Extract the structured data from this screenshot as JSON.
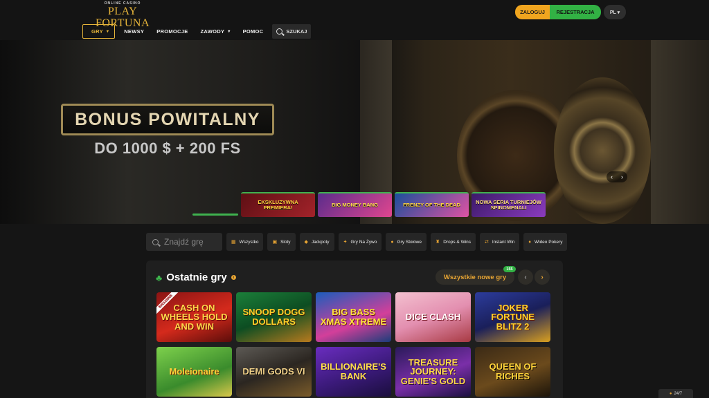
{
  "logo": {
    "subtitle": "ONLINE CASINO",
    "name": "PLAY FORTUNA"
  },
  "nav": {
    "items": [
      {
        "label": "GRY",
        "dropdown": true
      },
      {
        "label": "NEWSY"
      },
      {
        "label": "PROMOCJE"
      },
      {
        "label": "ZAWODY",
        "dropdown": true
      },
      {
        "label": "POMOC"
      }
    ],
    "search_label": "SZUKAJ",
    "caret": "▾"
  },
  "auth": {
    "login": "ZALOGUJ",
    "register": "REJESTRACJA"
  },
  "language": "PL ▾",
  "hero": {
    "title": "BONUS POWITALNY",
    "amount": "DO 1000 $ + 200 FS",
    "prev": "‹",
    "next": "›",
    "tabs": [
      {
        "label": "EKSKLUZYWNA PREMIERA!"
      },
      {
        "label": "BIG MONEY BANG"
      },
      {
        "label": "FRENZY OF THE DEAD"
      },
      {
        "label": "NOWA SERIA TURNIEJÓW SPINOMENALI"
      }
    ]
  },
  "filters": {
    "search_placeholder": "Znajdź grę",
    "chips": [
      {
        "icon": "▦",
        "label": "Wszystko"
      },
      {
        "icon": "▣",
        "label": "Sloty"
      },
      {
        "icon": "◆",
        "label": "Jackpoty"
      },
      {
        "icon": "✦",
        "label": "Gry Na Żywo"
      },
      {
        "icon": "●",
        "label": "Gry Stołowe"
      },
      {
        "icon": "♜",
        "label": "Drops & Wins"
      },
      {
        "icon": "⇄",
        "label": "Instant Win"
      },
      {
        "icon": "♦",
        "label": "Wideo Pokery"
      }
    ]
  },
  "recent": {
    "icon": "♣",
    "title": "Ostatnie gry",
    "info": "i",
    "all_new": "Wszystkie nowe gry",
    "count": "155",
    "prev": "‹",
    "next": "›",
    "games": [
      {
        "name": "CASH ON WHEELS HOLD AND WIN",
        "badge": "EXCLUSIVE"
      },
      {
        "name": "SNOOP DOGG DOLLARS"
      },
      {
        "name": "BIG BASS XMAS XTREME"
      },
      {
        "name": "DICE CLASH"
      },
      {
        "name": "JOKER FORTUNE BLITZ 2"
      },
      {
        "name": "Moleionaire"
      },
      {
        "name": "DEMI GODS VI"
      },
      {
        "name": "BILLIONAIRE'S BANK"
      },
      {
        "name": "TREASURE JOURNEY: GENIE'S GOLD"
      },
      {
        "name": "QUEEN OF RICHES"
      }
    ]
  },
  "chat": {
    "icon": "●",
    "label": "24/7"
  }
}
